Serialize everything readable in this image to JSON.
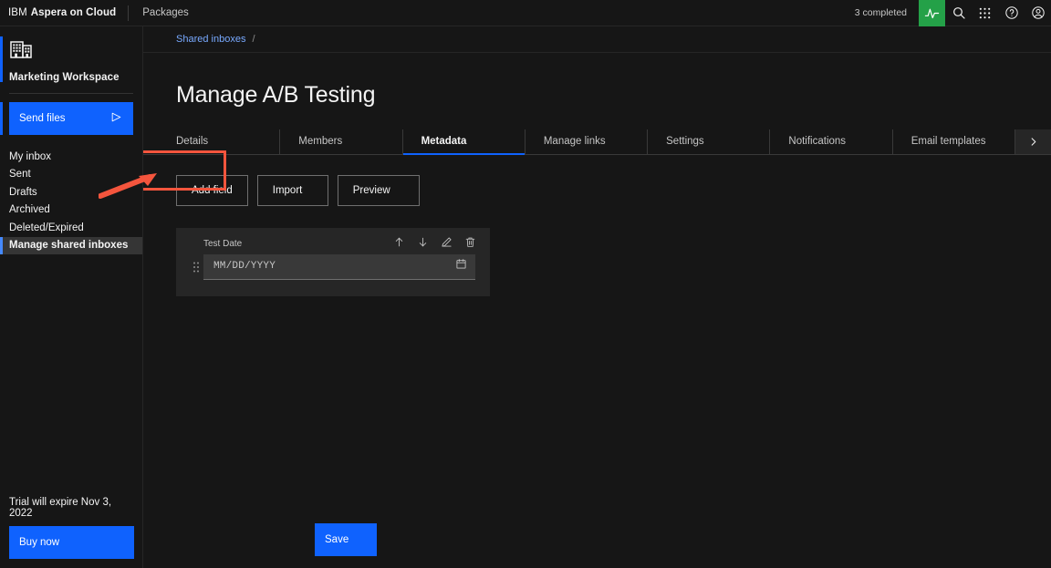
{
  "header": {
    "brand_ibm": "IBM",
    "brand_product": "Aspera on Cloud",
    "packages_label": "Packages",
    "completed_status": "3 completed",
    "icons": {
      "activity": "activity-icon",
      "search": "search-icon",
      "app_switcher": "app-switcher-icon",
      "help": "help-icon",
      "account": "account-icon"
    },
    "accent_green": "#24a148"
  },
  "sidebar": {
    "workspace_name": "Marketing Workspace",
    "workspace_icon": "building-icon",
    "send_files_label": "Send files",
    "send_files_icon": "send-icon",
    "nav_items": [
      {
        "label": "My inbox",
        "selected": false
      },
      {
        "label": "Sent",
        "selected": false
      },
      {
        "label": "Drafts",
        "selected": false
      },
      {
        "label": "Archived",
        "selected": false
      },
      {
        "label": "Deleted/Expired",
        "selected": false
      },
      {
        "label": "Manage shared inboxes",
        "selected": true
      }
    ],
    "trial_text": "Trial will expire Nov 3, 2022",
    "buy_now_label": "Buy now",
    "accent_blue": "#0f62fe"
  },
  "breadcrumb": {
    "link": "Shared inboxes",
    "separator": "/"
  },
  "main": {
    "page_title": "Manage A/B Testing",
    "tabs": [
      {
        "label": "Details",
        "active": false
      },
      {
        "label": "Members",
        "active": false
      },
      {
        "label": "Metadata",
        "active": true
      },
      {
        "label": "Manage links",
        "active": false
      },
      {
        "label": "Settings",
        "active": false
      },
      {
        "label": "Notifications",
        "active": false
      },
      {
        "label": "Email templates",
        "active": false
      }
    ],
    "tab_scroll_icon": "chevron-right-icon",
    "actions": [
      {
        "label": "Add field",
        "highlighted": true
      },
      {
        "label": "Import",
        "highlighted": false
      },
      {
        "label": "Preview",
        "highlighted": false
      }
    ],
    "field_card": {
      "label": "Test Date",
      "placeholder": "MM/DD/YYYY",
      "value": "",
      "calendar_icon": "calendar-icon",
      "drag_handle_icon": "drag-handle-icon",
      "tools": [
        {
          "name": "move-up-icon"
        },
        {
          "name": "move-down-icon"
        },
        {
          "name": "edit-icon"
        },
        {
          "name": "delete-icon"
        }
      ]
    },
    "save_label": "Save"
  },
  "annotation": {
    "arrow_color": "#f4553d",
    "highlight_color": "#f4553d",
    "target": "Add field"
  }
}
